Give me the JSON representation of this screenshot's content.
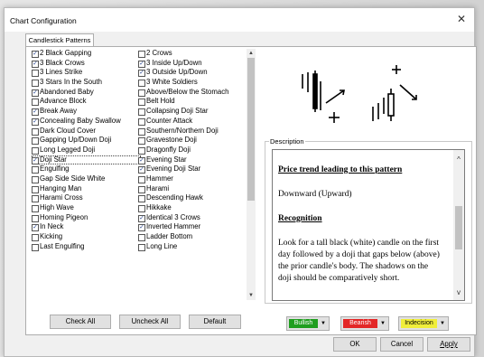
{
  "window": {
    "title": "Chart Configuration",
    "close_glyph": "✕"
  },
  "tab": {
    "label": "Candlestick Patterns"
  },
  "patterns_col1": [
    {
      "label": "2 Black Gapping",
      "checked": true
    },
    {
      "label": "3 Black Crows",
      "checked": true
    },
    {
      "label": "3 Lines Strike",
      "checked": false
    },
    {
      "label": "3 Stars In the South",
      "checked": false
    },
    {
      "label": "Abandoned Baby",
      "checked": true
    },
    {
      "label": "Advance Block",
      "checked": false
    },
    {
      "label": "Break Away",
      "checked": true
    },
    {
      "label": "Concealing Baby Swallow",
      "checked": true
    },
    {
      "label": "Dark Cloud Cover",
      "checked": false
    },
    {
      "label": "Gapping Up/Down Doji",
      "checked": false
    },
    {
      "label": "Long Legged Doji",
      "checked": false
    },
    {
      "label": "Doji Star",
      "checked": true,
      "focused": true
    },
    {
      "label": "Engulfing",
      "checked": false
    },
    {
      "label": "Gap Side Side White",
      "checked": false
    },
    {
      "label": "Hanging Man",
      "checked": false
    },
    {
      "label": "Harami Cross",
      "checked": false
    },
    {
      "label": "High Wave",
      "checked": false
    },
    {
      "label": "Homing Pigeon",
      "checked": false
    },
    {
      "label": "In Neck",
      "checked": true
    },
    {
      "label": "Kicking",
      "checked": false
    },
    {
      "label": "Last Engulfing",
      "checked": false
    }
  ],
  "patterns_col2": [
    {
      "label": "2 Crows",
      "checked": false
    },
    {
      "label": "3 Inside Up/Down",
      "checked": true
    },
    {
      "label": "3 Outside Up/Down",
      "checked": true
    },
    {
      "label": "3 White Soldiers",
      "checked": false
    },
    {
      "label": "Above/Below the Stomach",
      "checked": false
    },
    {
      "label": "Belt Hold",
      "checked": false
    },
    {
      "label": "Collapsing Doji Star",
      "checked": false
    },
    {
      "label": "Counter Attack",
      "checked": false
    },
    {
      "label": "Southern/Northern Doji",
      "checked": false
    },
    {
      "label": "Gravestone Doji",
      "checked": false
    },
    {
      "label": "Dragonfly Doji",
      "checked": false
    },
    {
      "label": "Evening Star",
      "checked": true
    },
    {
      "label": "Evening Doji Star",
      "checked": true
    },
    {
      "label": "Hammer",
      "checked": false
    },
    {
      "label": "Harami",
      "checked": false
    },
    {
      "label": "Descending Hawk",
      "checked": false
    },
    {
      "label": "Hikkake",
      "checked": false
    },
    {
      "label": "Identical 3 Crows",
      "checked": true
    },
    {
      "label": "Inverted Hammer",
      "checked": true
    },
    {
      "label": "Ladder Bottom",
      "checked": false
    },
    {
      "label": "Long Line",
      "checked": false
    }
  ],
  "list_buttons": {
    "check_all": "Check All",
    "uncheck_all": "Uncheck All",
    "default": "Default"
  },
  "description": {
    "label": "Description",
    "heading1": "Price trend leading to this pattern",
    "trend": "Downward (Upward)",
    "heading2": "Recognition",
    "body": "Look for a tall black (white) candle on the first day followed by a doji that gaps below (above) the prior candle's body. The shadows on the doji should be comparatively short."
  },
  "color_buttons": {
    "bullish": {
      "label": "Bullish",
      "color": "#1f9e1f"
    },
    "bearish": {
      "label": "Bearish",
      "color": "#e32727"
    },
    "indecision": {
      "label": "Indecision",
      "color": "#f0ee3a"
    }
  },
  "footer": {
    "ok": "OK",
    "cancel": "Cancel",
    "apply": "Apply"
  },
  "icons": {
    "check": "✓",
    "scroll_up": "▲",
    "scroll_down": "▼",
    "dropdown": "▼",
    "desc_up": "^",
    "desc_down": "v"
  }
}
